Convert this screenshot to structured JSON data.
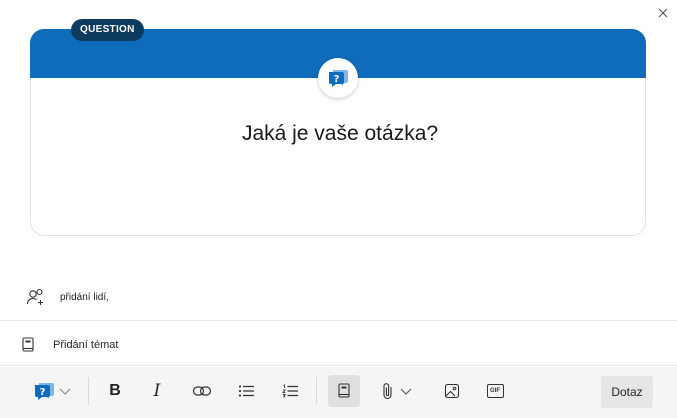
{
  "dialog": {
    "close_label": "×"
  },
  "card": {
    "badge": "QUESTION",
    "title": "Jaká je vaše otázka?",
    "header_color": "#0f6cbd",
    "badge_color": "#0c3b5e",
    "icon": "question-bubble-icon"
  },
  "people": {
    "label": "přidání lidí,",
    "icon": "add-people-icon"
  },
  "topics": {
    "label": "Přidání témat",
    "icon": "book-icon"
  },
  "toolbar": {
    "post_type_icon": "question-bubble-icon",
    "bold_label": "B",
    "italic_label": "I",
    "gif_label": "GIF",
    "submit_label": "Dotaz"
  }
}
